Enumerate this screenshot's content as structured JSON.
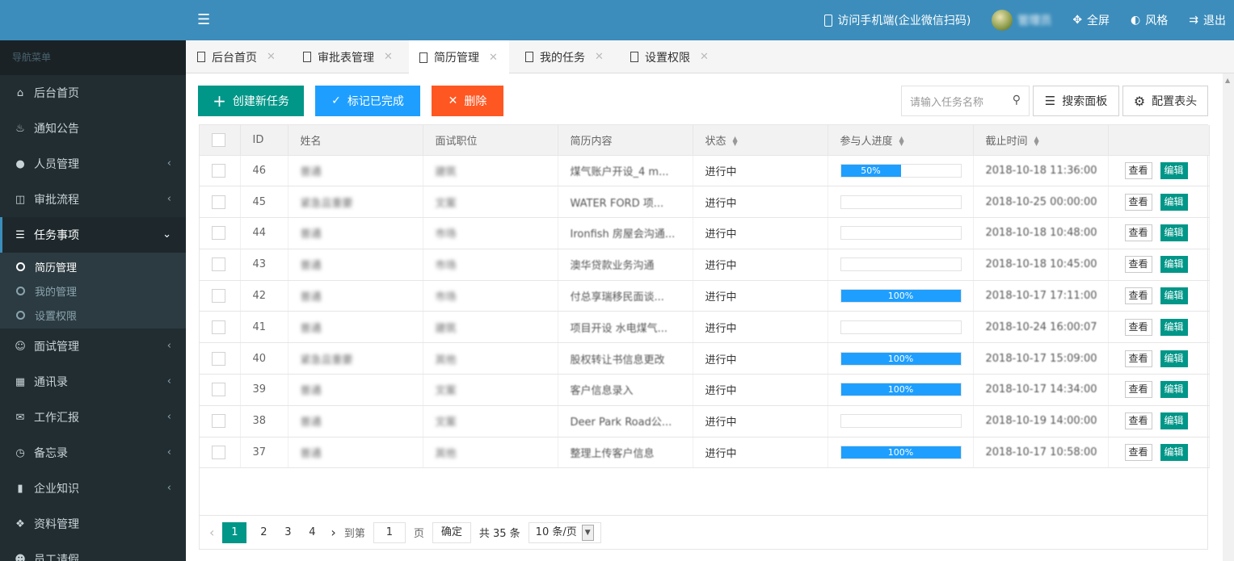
{
  "header": {
    "mobile_link": "访问手机端(企业微信扫码)",
    "username": "管理员",
    "fullscreen": "全屏",
    "theme": "风格",
    "logout": "退出"
  },
  "sidebar": {
    "title": "导航菜单",
    "items": [
      {
        "label": "后台首页",
        "icon": "home-icon"
      },
      {
        "label": "通知公告",
        "icon": "bell-icon"
      },
      {
        "label": "人员管理",
        "icon": "user-icon"
      },
      {
        "label": "审批流程",
        "icon": "approval-icon"
      },
      {
        "label": "任务事项",
        "icon": "tasks-icon"
      },
      {
        "label": "面试管理",
        "icon": "users-icon"
      },
      {
        "label": "通讯录",
        "icon": "contacts-icon"
      },
      {
        "label": "工作汇报",
        "icon": "envelope-icon"
      },
      {
        "label": "备忘录",
        "icon": "clock-icon"
      },
      {
        "label": "企业知识",
        "icon": "book-icon"
      },
      {
        "label": "资料管理",
        "icon": "tag-icon"
      },
      {
        "label": "员工请假",
        "icon": "user-leave-icon"
      }
    ],
    "subitems": [
      "简历管理",
      "我的管理",
      "设置权限"
    ]
  },
  "tabs": [
    "后台首页",
    "审批表管理",
    "简历管理",
    "我的任务",
    "设置权限"
  ],
  "toolbar": {
    "create": "创建新任务",
    "mark_done": "标记已完成",
    "delete": "删除",
    "search_placeholder": "请输入任务名称",
    "search_panel": "搜索面板",
    "config_header": "配置表头"
  },
  "table": {
    "headers": [
      "ID",
      "姓名",
      "面试职位",
      "简历内容",
      "状态",
      "参与人进度",
      "截止时间"
    ],
    "view_label": "查看",
    "edit_label": "编辑",
    "rows": [
      {
        "id": "46",
        "name": "普通",
        "position": "建筑",
        "content": "煤气账户开设_4 m...",
        "status": "进行中",
        "progress": 0.5,
        "progress_text": "50%",
        "deadline": "2018-10-18 11:36:00"
      },
      {
        "id": "45",
        "name": "紧急且重要",
        "position": "文案",
        "content": "WATER FORD 项...",
        "status": "进行中",
        "progress": 0,
        "progress_text": "",
        "deadline": "2018-10-25 00:00:00"
      },
      {
        "id": "44",
        "name": "普通",
        "position": "市场",
        "content": "Ironfish 房屋会沟通...",
        "status": "进行中",
        "progress": 0,
        "progress_text": "",
        "deadline": "2018-10-18 10:48:00"
      },
      {
        "id": "43",
        "name": "普通",
        "position": "市场",
        "content": "澳华贷款业务沟通",
        "status": "进行中",
        "progress": 0,
        "progress_text": "",
        "deadline": "2018-10-18 10:45:00"
      },
      {
        "id": "42",
        "name": "普通",
        "position": "市场",
        "content": "付总享瑞移民面谈...",
        "status": "进行中",
        "progress": 1,
        "progress_text": "100%",
        "deadline": "2018-10-17 17:11:00"
      },
      {
        "id": "41",
        "name": "普通",
        "position": "建筑",
        "content": "项目开设 水电煤气...",
        "status": "进行中",
        "progress": 0,
        "progress_text": "",
        "deadline": "2018-10-24 16:00:07"
      },
      {
        "id": "40",
        "name": "紧急且重要",
        "position": "其他",
        "content": "股权转让书信息更改",
        "status": "进行中",
        "progress": 1,
        "progress_text": "100%",
        "deadline": "2018-10-17 15:09:00"
      },
      {
        "id": "39",
        "name": "普通",
        "position": "文案",
        "content": "客户信息录入",
        "status": "进行中",
        "progress": 1,
        "progress_text": "100%",
        "deadline": "2018-10-17 14:34:00"
      },
      {
        "id": "38",
        "name": "普通",
        "position": "文案",
        "content": "Deer Park Road公...",
        "status": "进行中",
        "progress": 0,
        "progress_text": "",
        "deadline": "2018-10-19 14:00:00"
      },
      {
        "id": "37",
        "name": "普通",
        "position": "其他",
        "content": "整理上传客户信息",
        "status": "进行中",
        "progress": 1,
        "progress_text": "100%",
        "deadline": "2018-10-17 10:58:00"
      }
    ]
  },
  "pagination": {
    "pages": [
      "1",
      "2",
      "3",
      "4"
    ],
    "current": "1",
    "goto_label": "到第",
    "goto_value": "1",
    "page_unit": "页",
    "confirm": "确定",
    "total": "共 35 条",
    "page_size": "10 条/页"
  },
  "colors": {
    "header_bg": "#3c8dbc",
    "sidebar_bg": "#222d32",
    "primary": "#009688",
    "blue": "#1e9fff",
    "danger": "#ff5722"
  }
}
